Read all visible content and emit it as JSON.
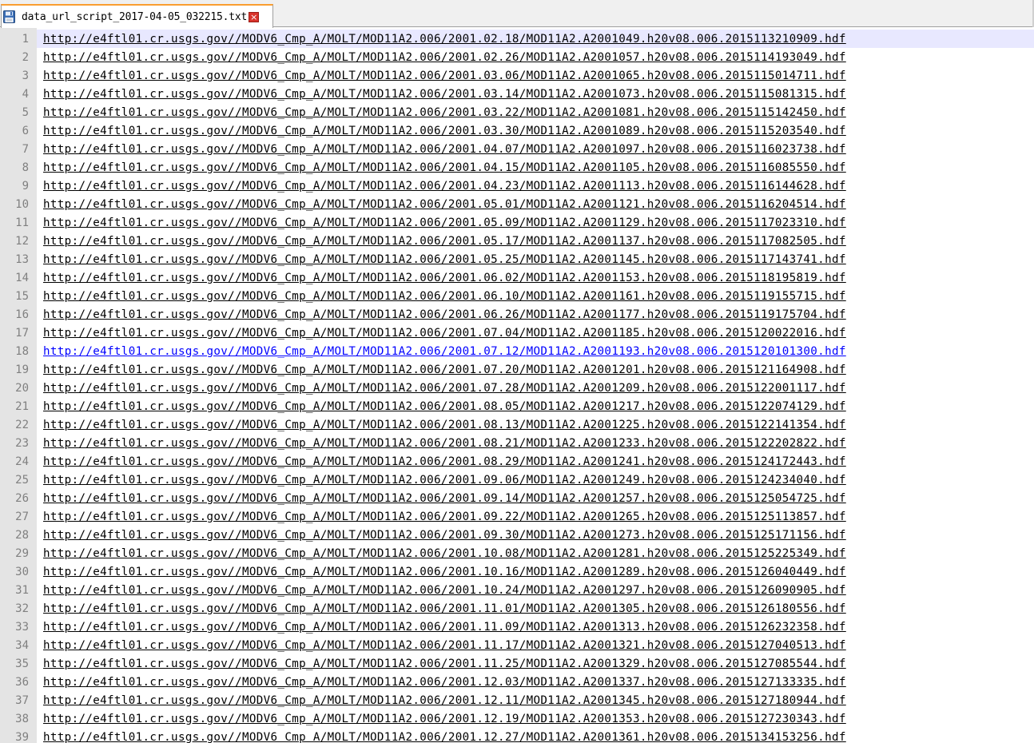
{
  "tab": {
    "title": "data_url_script_2017-04-05_032215.txt",
    "icon": "save-disk-icon",
    "close_icon": "close-icon",
    "close_glyph": "×"
  },
  "editor": {
    "current_line": 1,
    "hover_line": 18,
    "lines": [
      {
        "n": "1",
        "text": "http://e4ftl01.cr.usgs.gov//MODV6_Cmp_A/MOLT/MOD11A2.006/2001.02.18/MOD11A2.A2001049.h20v08.006.2015113210909.hdf"
      },
      {
        "n": "2",
        "text": "http://e4ftl01.cr.usgs.gov//MODV6_Cmp_A/MOLT/MOD11A2.006/2001.02.26/MOD11A2.A2001057.h20v08.006.2015114193049.hdf"
      },
      {
        "n": "3",
        "text": "http://e4ftl01.cr.usgs.gov//MODV6_Cmp_A/MOLT/MOD11A2.006/2001.03.06/MOD11A2.A2001065.h20v08.006.2015115014711.hdf"
      },
      {
        "n": "4",
        "text": "http://e4ftl01.cr.usgs.gov//MODV6_Cmp_A/MOLT/MOD11A2.006/2001.03.14/MOD11A2.A2001073.h20v08.006.2015115081315.hdf"
      },
      {
        "n": "5",
        "text": "http://e4ftl01.cr.usgs.gov//MODV6_Cmp_A/MOLT/MOD11A2.006/2001.03.22/MOD11A2.A2001081.h20v08.006.2015115142450.hdf"
      },
      {
        "n": "6",
        "text": "http://e4ftl01.cr.usgs.gov//MODV6_Cmp_A/MOLT/MOD11A2.006/2001.03.30/MOD11A2.A2001089.h20v08.006.2015115203540.hdf"
      },
      {
        "n": "7",
        "text": "http://e4ftl01.cr.usgs.gov//MODV6_Cmp_A/MOLT/MOD11A2.006/2001.04.07/MOD11A2.A2001097.h20v08.006.2015116023738.hdf"
      },
      {
        "n": "8",
        "text": "http://e4ftl01.cr.usgs.gov//MODV6_Cmp_A/MOLT/MOD11A2.006/2001.04.15/MOD11A2.A2001105.h20v08.006.2015116085550.hdf"
      },
      {
        "n": "9",
        "text": "http://e4ftl01.cr.usgs.gov//MODV6_Cmp_A/MOLT/MOD11A2.006/2001.04.23/MOD11A2.A2001113.h20v08.006.2015116144628.hdf"
      },
      {
        "n": "10",
        "text": "http://e4ftl01.cr.usgs.gov//MODV6_Cmp_A/MOLT/MOD11A2.006/2001.05.01/MOD11A2.A2001121.h20v08.006.2015116204514.hdf"
      },
      {
        "n": "11",
        "text": "http://e4ftl01.cr.usgs.gov//MODV6_Cmp_A/MOLT/MOD11A2.006/2001.05.09/MOD11A2.A2001129.h20v08.006.2015117023310.hdf"
      },
      {
        "n": "12",
        "text": "http://e4ftl01.cr.usgs.gov//MODV6_Cmp_A/MOLT/MOD11A2.006/2001.05.17/MOD11A2.A2001137.h20v08.006.2015117082505.hdf"
      },
      {
        "n": "13",
        "text": "http://e4ftl01.cr.usgs.gov//MODV6_Cmp_A/MOLT/MOD11A2.006/2001.05.25/MOD11A2.A2001145.h20v08.006.2015117143741.hdf"
      },
      {
        "n": "14",
        "text": "http://e4ftl01.cr.usgs.gov//MODV6_Cmp_A/MOLT/MOD11A2.006/2001.06.02/MOD11A2.A2001153.h20v08.006.2015118195819.hdf"
      },
      {
        "n": "15",
        "text": "http://e4ftl01.cr.usgs.gov//MODV6_Cmp_A/MOLT/MOD11A2.006/2001.06.10/MOD11A2.A2001161.h20v08.006.2015119155715.hdf"
      },
      {
        "n": "16",
        "text": "http://e4ftl01.cr.usgs.gov//MODV6_Cmp_A/MOLT/MOD11A2.006/2001.06.26/MOD11A2.A2001177.h20v08.006.2015119175704.hdf"
      },
      {
        "n": "17",
        "text": "http://e4ftl01.cr.usgs.gov//MODV6_Cmp_A/MOLT/MOD11A2.006/2001.07.04/MOD11A2.A2001185.h20v08.006.2015120022016.hdf"
      },
      {
        "n": "18",
        "text": "http://e4ftl01.cr.usgs.gov//MODV6_Cmp_A/MOLT/MOD11A2.006/2001.07.12/MOD11A2.A2001193.h20v08.006.2015120101300.hdf"
      },
      {
        "n": "19",
        "text": "http://e4ftl01.cr.usgs.gov//MODV6_Cmp_A/MOLT/MOD11A2.006/2001.07.20/MOD11A2.A2001201.h20v08.006.2015121164908.hdf"
      },
      {
        "n": "20",
        "text": "http://e4ftl01.cr.usgs.gov//MODV6_Cmp_A/MOLT/MOD11A2.006/2001.07.28/MOD11A2.A2001209.h20v08.006.2015122001117.hdf"
      },
      {
        "n": "21",
        "text": "http://e4ftl01.cr.usgs.gov//MODV6_Cmp_A/MOLT/MOD11A2.006/2001.08.05/MOD11A2.A2001217.h20v08.006.2015122074129.hdf"
      },
      {
        "n": "22",
        "text": "http://e4ftl01.cr.usgs.gov//MODV6_Cmp_A/MOLT/MOD11A2.006/2001.08.13/MOD11A2.A2001225.h20v08.006.2015122141354.hdf"
      },
      {
        "n": "23",
        "text": "http://e4ftl01.cr.usgs.gov//MODV6_Cmp_A/MOLT/MOD11A2.006/2001.08.21/MOD11A2.A2001233.h20v08.006.2015122202822.hdf"
      },
      {
        "n": "24",
        "text": "http://e4ftl01.cr.usgs.gov//MODV6_Cmp_A/MOLT/MOD11A2.006/2001.08.29/MOD11A2.A2001241.h20v08.006.2015124172443.hdf"
      },
      {
        "n": "25",
        "text": "http://e4ftl01.cr.usgs.gov//MODV6_Cmp_A/MOLT/MOD11A2.006/2001.09.06/MOD11A2.A2001249.h20v08.006.2015124234040.hdf"
      },
      {
        "n": "26",
        "text": "http://e4ftl01.cr.usgs.gov//MODV6_Cmp_A/MOLT/MOD11A2.006/2001.09.14/MOD11A2.A2001257.h20v08.006.2015125054725.hdf"
      },
      {
        "n": "27",
        "text": "http://e4ftl01.cr.usgs.gov//MODV6_Cmp_A/MOLT/MOD11A2.006/2001.09.22/MOD11A2.A2001265.h20v08.006.2015125113857.hdf"
      },
      {
        "n": "28",
        "text": "http://e4ftl01.cr.usgs.gov//MODV6_Cmp_A/MOLT/MOD11A2.006/2001.09.30/MOD11A2.A2001273.h20v08.006.2015125171156.hdf"
      },
      {
        "n": "29",
        "text": "http://e4ftl01.cr.usgs.gov//MODV6_Cmp_A/MOLT/MOD11A2.006/2001.10.08/MOD11A2.A2001281.h20v08.006.2015125225349.hdf"
      },
      {
        "n": "30",
        "text": "http://e4ftl01.cr.usgs.gov//MODV6_Cmp_A/MOLT/MOD11A2.006/2001.10.16/MOD11A2.A2001289.h20v08.006.2015126040449.hdf"
      },
      {
        "n": "31",
        "text": "http://e4ftl01.cr.usgs.gov//MODV6_Cmp_A/MOLT/MOD11A2.006/2001.10.24/MOD11A2.A2001297.h20v08.006.2015126090905.hdf"
      },
      {
        "n": "32",
        "text": "http://e4ftl01.cr.usgs.gov//MODV6_Cmp_A/MOLT/MOD11A2.006/2001.11.01/MOD11A2.A2001305.h20v08.006.2015126180556.hdf"
      },
      {
        "n": "33",
        "text": "http://e4ftl01.cr.usgs.gov//MODV6_Cmp_A/MOLT/MOD11A2.006/2001.11.09/MOD11A2.A2001313.h20v08.006.2015126232358.hdf"
      },
      {
        "n": "34",
        "text": "http://e4ftl01.cr.usgs.gov//MODV6_Cmp_A/MOLT/MOD11A2.006/2001.11.17/MOD11A2.A2001321.h20v08.006.2015127040513.hdf"
      },
      {
        "n": "35",
        "text": "http://e4ftl01.cr.usgs.gov//MODV6_Cmp_A/MOLT/MOD11A2.006/2001.11.25/MOD11A2.A2001329.h20v08.006.2015127085544.hdf"
      },
      {
        "n": "36",
        "text": "http://e4ftl01.cr.usgs.gov//MODV6_Cmp_A/MOLT/MOD11A2.006/2001.12.03/MOD11A2.A2001337.h20v08.006.2015127133335.hdf"
      },
      {
        "n": "37",
        "text": "http://e4ftl01.cr.usgs.gov//MODV6_Cmp_A/MOLT/MOD11A2.006/2001.12.11/MOD11A2.A2001345.h20v08.006.2015127180944.hdf"
      },
      {
        "n": "38",
        "text": "http://e4ftl01.cr.usgs.gov//MODV6_Cmp_A/MOLT/MOD11A2.006/2001.12.19/MOD11A2.A2001353.h20v08.006.2015127230343.hdf"
      },
      {
        "n": "39",
        "text": "http://e4ftl01.cr.usgs.gov//MODV6_Cmp_A/MOLT/MOD11A2.006/2001.12.27/MOD11A2.A2001361.h20v08.006.2015134153256.hdf"
      }
    ]
  },
  "colors": {
    "gutter_bg": "#e4e4e4",
    "line_number": "#808080",
    "current_line_bg": "#e8e8ff",
    "hover_link": "#0000ff",
    "text": "#000000",
    "tab_accent": "#fa9e30"
  }
}
